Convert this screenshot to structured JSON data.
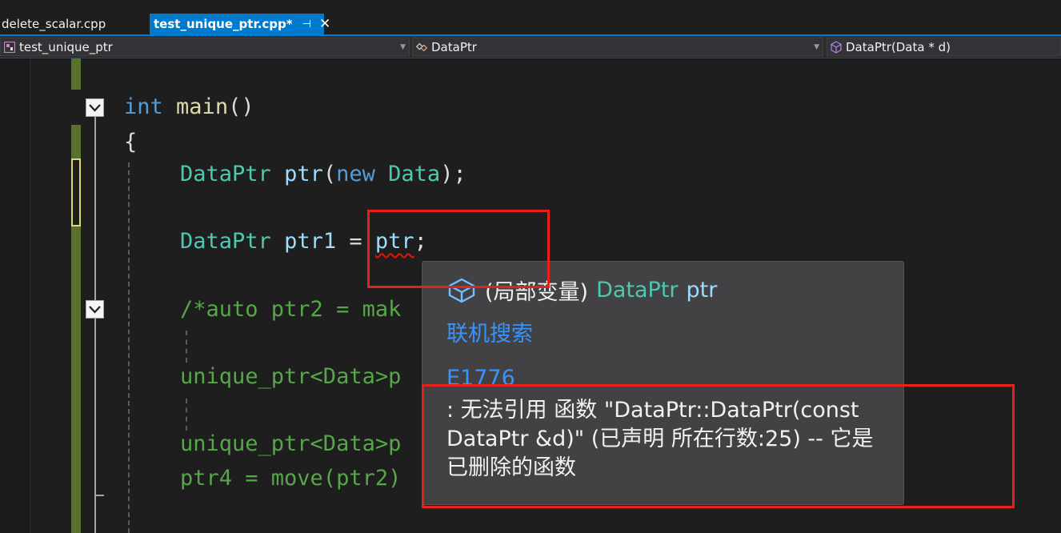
{
  "tabs": [
    {
      "label": "delete_scalar.cpp",
      "active": false
    },
    {
      "label": "test_unique_ptr.cpp*",
      "active": true,
      "pin_icon": "pin-icon",
      "close_icon": "close-icon"
    }
  ],
  "navbar": {
    "project": "test_unique_ptr",
    "scope": "DataPtr",
    "member": "DataPtr(Data * d)"
  },
  "code": {
    "line1": {
      "kw": "int",
      "fn": "main",
      "rest": "()"
    },
    "line2": "{",
    "line3": {
      "type": "DataPtr",
      "var": "ptr",
      "p1": "(",
      "kw": "new",
      "type2": "Data",
      "p2": ");"
    },
    "line4": {
      "type": "DataPtr",
      "var": "ptr1",
      "eq": "=",
      "rhs": "ptr",
      "semi": ";"
    },
    "line5": "/*auto ptr2 = mak",
    "line6": "unique_ptr<Data>p",
    "line7": "unique_ptr<Data>p",
    "line8": "ptr4 = move(ptr2)"
  },
  "tooltip": {
    "prefix": "(局部变量)",
    "type": "DataPtr",
    "var": "ptr",
    "search_link": "联机搜索",
    "error_code": "E1776",
    "message": ": 无法引用 函数 \"DataPtr::DataPtr(const DataPtr &d)\" (已声明 所在行数:25) -- 它是已删除的函数"
  },
  "colors": {
    "accent": "#007acc",
    "annotation_red": "#e8201b",
    "keyword": "#569cd6",
    "type": "#4ec9b0",
    "variable": "#9cdcfe",
    "function": "#dcdcaa",
    "comment": "#57a64a",
    "link": "#3794ff"
  }
}
